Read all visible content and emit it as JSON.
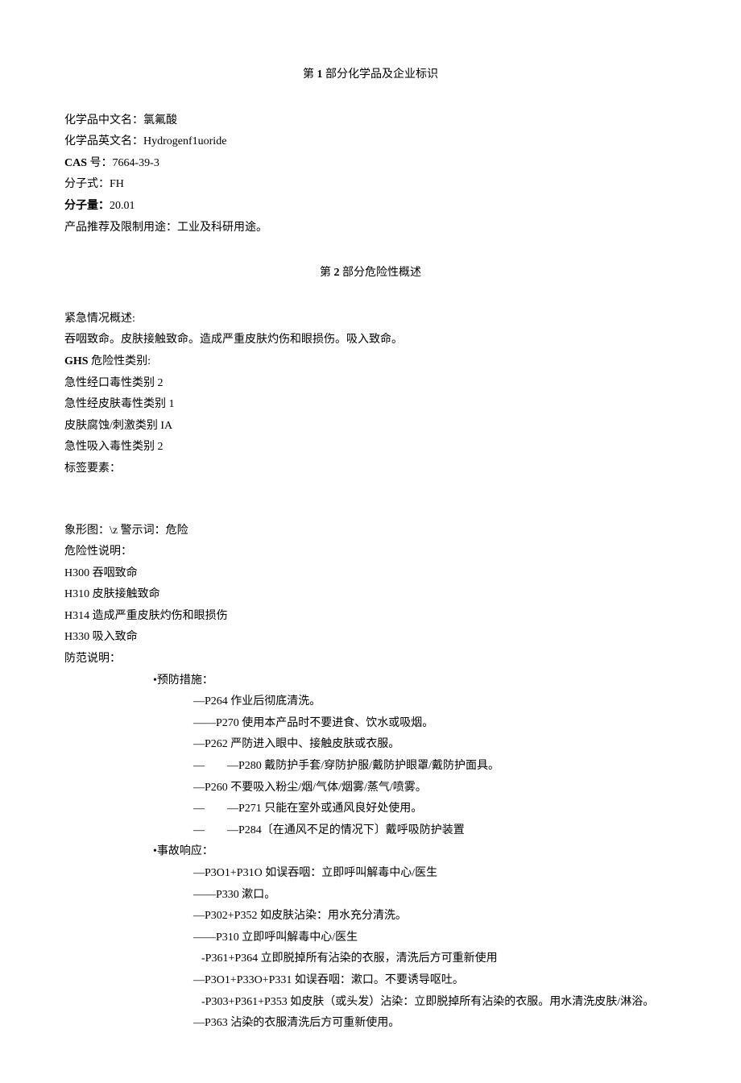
{
  "section1": {
    "heading_prefix": "第",
    "heading_num": "1",
    "heading_suffix": "部分化学品及企业标识",
    "name_cn_label": "化学品中文名：",
    "name_cn_value": "氯氟酸",
    "name_en_label": "化学品英文名：",
    "name_en_value": "Hydrogenf1uoride",
    "cas_label": "CAS",
    "cas_suffix": "号：",
    "cas_value": "7664-39-3",
    "formula_label": "分子式：",
    "formula_value": "FH",
    "mw_label": "分子量：",
    "mw_value": "20.01",
    "use_label": "产品推荐及限制用途：",
    "use_value": "工业及科研用途。"
  },
  "section2": {
    "heading_prefix": "第",
    "heading_num": "2",
    "heading_suffix": "部分危险性概述",
    "emergency_label": "紧急情况概述:",
    "emergency_text": "吞咽致命。皮肤接触致命。造成严重皮肤灼伤和眼损伤。吸入致命。",
    "ghs_label_bold": "GHS",
    "ghs_label_rest": "危险性类别:",
    "ghs_items": [
      "急性经口毒性类别 2",
      "急性经皮肤毒性类别 1",
      "皮肤腐蚀/刺激类别 IA",
      "急性吸入毒性类别 2"
    ],
    "label_elements": "标签要素：",
    "pictogram_line": "象形图：\\z 警示词：危险",
    "hazard_desc_label": "危险性说明：",
    "hazard_items": [
      "H300 吞咽致命",
      "H310 皮肤接触致命",
      "H314 造成严重皮肤灼伤和眼损伤",
      "H330 吸入致命"
    ],
    "precaution_label": "防范说明：",
    "prevention_label": "•预防措施：",
    "prevention_items": [
      "—P264 作业后彻底清洗。",
      "——P270 使用本产品时不要进食、饮水或吸烟。",
      "—P262 严防进入眼中、接触皮肤或衣服。",
      "—　　—P280 戴防护手套/穿防护服/戴防护眼罩/戴防护面具。",
      "—P260 不要吸入粉尘/烟/气体/烟雾/蒸气/喷雾。",
      "—　　—P271 只能在室外或通风良好处使用。",
      "—　　—P284〔在通风不足的情况下〕戴呼吸防护装置"
    ],
    "response_label": "•事故响应：",
    "response_items": [
      "—P3O1+P31O 如误吞咽：立即呼叫解毒中心/医生",
      "——P330 漱口。",
      "—P302+P352 如皮肤沾染：用水充分清洗。",
      "——P310 立即呼叫解毒中心/医生",
      "-P361+P364 立即脱掉所有沾染的衣服，清洗后方可重新使用",
      "—P3O1+P33O+P331 如误吞咽：漱口。不要诱导呕吐。",
      "-P303+P361+P353 如皮肤（或头发）沾染：立即脱掉所有沾染的衣服。用水清洗皮肤/淋浴。",
      "—P363 沾染的衣服清洗后方可重新使用。"
    ]
  }
}
